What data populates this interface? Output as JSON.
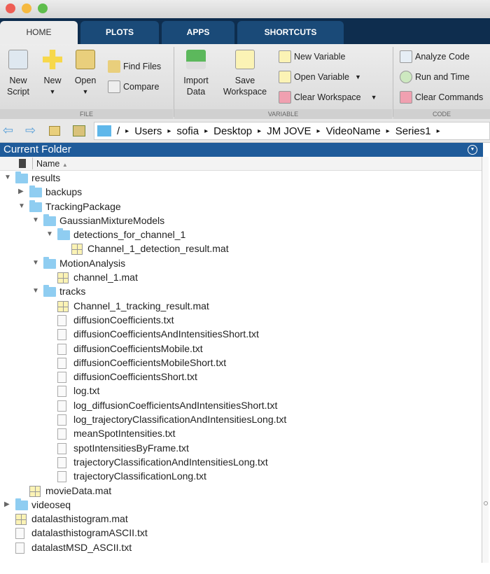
{
  "window": {
    "dots": [
      "#ee5e55",
      "#f5b940",
      "#5ebd4c"
    ]
  },
  "tabs": [
    {
      "label": "HOME",
      "active": true
    },
    {
      "label": "PLOTS"
    },
    {
      "label": "APPS"
    },
    {
      "label": "SHORTCUTS"
    }
  ],
  "ribbon": {
    "file": {
      "section": "FILE",
      "new_script": "New\nScript",
      "new": "New",
      "open": "Open",
      "find_files": "Find Files",
      "compare": "Compare"
    },
    "variable": {
      "section": "VARIABLE",
      "import_data": "Import\nData",
      "save_workspace": "Save\nWorkspace",
      "new_variable": "New Variable",
      "open_variable": "Open Variable",
      "clear_workspace": "Clear Workspace"
    },
    "code": {
      "section": "CODE",
      "analyze_code": "Analyze Code",
      "run_and_time": "Run and Time",
      "clear_commands": "Clear Commands"
    }
  },
  "path": [
    "/",
    "Users",
    "sofia",
    "Desktop",
    "JM JOVE",
    "VideoName",
    "Series1"
  ],
  "panel": {
    "title": "Current Folder",
    "column_name": "Name"
  },
  "tree": [
    {
      "name": "results",
      "type": "folder",
      "depth": 0,
      "state": "open"
    },
    {
      "name": "backups",
      "type": "folder",
      "depth": 1,
      "state": "closed"
    },
    {
      "name": "TrackingPackage",
      "type": "folder",
      "depth": 1,
      "state": "open"
    },
    {
      "name": "GaussianMixtureModels",
      "type": "folder",
      "depth": 2,
      "state": "open"
    },
    {
      "name": "detections_for_channel_1",
      "type": "folder",
      "depth": 3,
      "state": "open"
    },
    {
      "name": "Channel_1_detection_result.mat",
      "type": "mat",
      "depth": 4
    },
    {
      "name": "MotionAnalysis",
      "type": "folder",
      "depth": 2,
      "state": "open"
    },
    {
      "name": "channel_1.mat",
      "type": "mat",
      "depth": 3
    },
    {
      "name": "tracks",
      "type": "folder",
      "depth": 2,
      "state": "open"
    },
    {
      "name": "Channel_1_tracking_result.mat",
      "type": "mat",
      "depth": 3
    },
    {
      "name": "diffusionCoefficients.txt",
      "type": "txt",
      "depth": 3
    },
    {
      "name": "diffusionCoefficientsAndIntensitiesShort.txt",
      "type": "txt",
      "depth": 3
    },
    {
      "name": "diffusionCoefficientsMobile.txt",
      "type": "txt",
      "depth": 3
    },
    {
      "name": "diffusionCoefficientsMobileShort.txt",
      "type": "txt",
      "depth": 3
    },
    {
      "name": "diffusionCoefficientsShort.txt",
      "type": "txt",
      "depth": 3
    },
    {
      "name": "log.txt",
      "type": "txt",
      "depth": 3
    },
    {
      "name": "log_diffusionCoefficientsAndIntensitiesShort.txt",
      "type": "txt",
      "depth": 3
    },
    {
      "name": "log_trajectoryClassificationAndIntensitiesLong.txt",
      "type": "txt",
      "depth": 3
    },
    {
      "name": "meanSpotIntensities.txt",
      "type": "txt",
      "depth": 3
    },
    {
      "name": "spotIntensitiesByFrame.txt",
      "type": "txt",
      "depth": 3
    },
    {
      "name": "trajectoryClassificationAndIntensitiesLong.txt",
      "type": "txt",
      "depth": 3
    },
    {
      "name": "trajectoryClassificationLong.txt",
      "type": "txt",
      "depth": 3
    },
    {
      "name": "movieData.mat",
      "type": "mat",
      "depth": 1
    },
    {
      "name": "videoseq",
      "type": "folder",
      "depth": 0,
      "state": "closed"
    },
    {
      "name": "datalasthistogram.mat",
      "type": "mat",
      "depth": 0
    },
    {
      "name": "datalasthistogramASCII.txt",
      "type": "txt",
      "depth": 0
    },
    {
      "name": "datalastMSD_ASCII.txt",
      "type": "txt",
      "depth": 0
    }
  ]
}
